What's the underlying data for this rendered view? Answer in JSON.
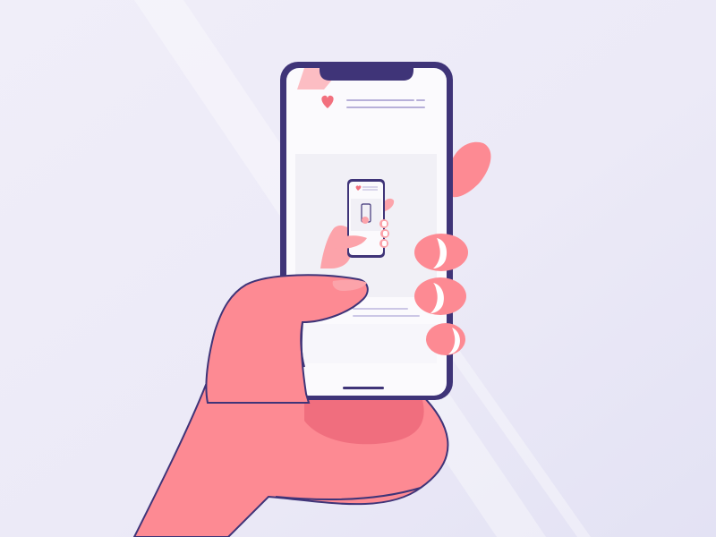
{
  "illustration": {
    "subject": "hand-holding-phone-recursive",
    "colors": {
      "background_light": "#f1eff9",
      "background_dark": "#e4e3f4",
      "phone_frame": "#3f3478",
      "screen": "#fbfafd",
      "screen_panel": "#f1f0f6",
      "skin": "#fd8a93",
      "skin_shadow": "#f06e7e",
      "skin_highlight": "#fca3aa",
      "nail": "#ffffff",
      "heart": "#f2707e",
      "placeholder_line": "#b7b0d9",
      "placeholder_line_light": "#ccc7e6"
    }
  }
}
